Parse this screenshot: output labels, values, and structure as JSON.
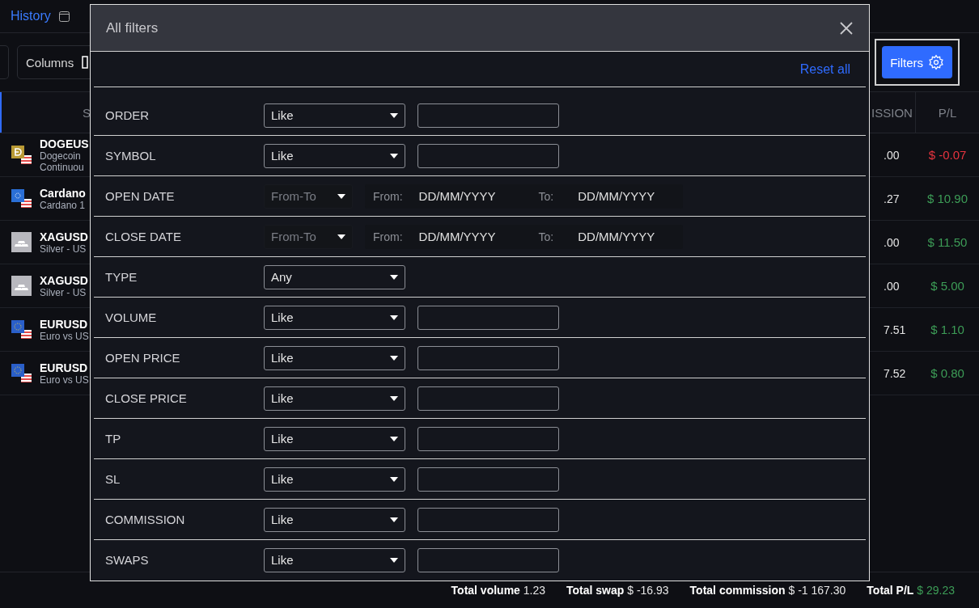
{
  "header": {
    "tab": "History"
  },
  "toolbar": {
    "columns_button": "Columns",
    "filters_button": "Filters"
  },
  "table": {
    "columns": [
      "S",
      "ISSION",
      "P/L"
    ],
    "rows": [
      {
        "kind": "doge",
        "symbol": "DOGEUS",
        "lines": [
          "Dogecoin",
          "Continuou"
        ],
        "commission": ".00",
        "pl": "$ -0.07",
        "color": "#e8343f"
      },
      {
        "kind": "cardano",
        "symbol": "Cardano",
        "lines": [
          "Cardano 1"
        ],
        "commission": ".27",
        "pl": "$ 10.90",
        "color": "#3d9d57"
      },
      {
        "kind": "metal",
        "symbol": "XAGUSD",
        "lines": [
          "Silver - US"
        ],
        "commission": ".00",
        "pl": "$ 11.50",
        "color": "#3d9d57"
      },
      {
        "kind": "metal",
        "symbol": "XAGUSD",
        "lines": [
          "Silver - US"
        ],
        "commission": ".00",
        "pl": "$ 5.00",
        "color": "#3d9d57"
      },
      {
        "kind": "euro",
        "symbol": "EURUSD",
        "lines": [
          "Euro vs US"
        ],
        "commission": "7.51",
        "pl": "$ 1.10",
        "color": "#3d9d57"
      },
      {
        "kind": "euro",
        "symbol": "EURUSD",
        "lines": [
          "Euro vs US"
        ],
        "commission": "7.52",
        "pl": "$ 0.80",
        "color": "#3d9d57"
      }
    ]
  },
  "totals": [
    {
      "label": "Total volume",
      "value": "1.23",
      "color": "#e6e6e6"
    },
    {
      "label": "Total swap",
      "value": "$ -16.93",
      "color": "#e6e6e6"
    },
    {
      "label": "Total commission",
      "value": "$ -1 167.30",
      "color": "#e6e6e6"
    },
    {
      "label": "Total P/L",
      "value": "$ 29.23",
      "color": "#3d9d57"
    }
  ],
  "dialog": {
    "title": "All filters",
    "reset": "Reset all",
    "filters": [
      {
        "kind": "text",
        "label": "ORDER",
        "operator": "Like"
      },
      {
        "kind": "text",
        "label": "SYMBOL",
        "operator": "Like"
      },
      {
        "kind": "date",
        "label": "OPEN DATE",
        "operator": "From-To",
        "from_label": "From:",
        "from_placeholder": "DD/MM/YYYY",
        "to_label": "To:",
        "to_placeholder": "DD/MM/YYYY"
      },
      {
        "kind": "date",
        "label": "CLOSE DATE",
        "operator": "From-To",
        "from_label": "From:",
        "from_placeholder": "DD/MM/YYYY",
        "to_label": "To:",
        "to_placeholder": "DD/MM/YYYY"
      },
      {
        "kind": "select",
        "label": "TYPE",
        "operator": "Any"
      },
      {
        "kind": "text",
        "label": "VOLUME",
        "operator": "Like"
      },
      {
        "kind": "text",
        "label": "OPEN PRICE",
        "operator": "Like"
      },
      {
        "kind": "text",
        "label": "CLOSE PRICE",
        "operator": "Like"
      },
      {
        "kind": "text",
        "label": "TP",
        "operator": "Like"
      },
      {
        "kind": "text",
        "label": "SL",
        "operator": "Like"
      },
      {
        "kind": "text",
        "label": "COMMISSION",
        "operator": "Like"
      },
      {
        "kind": "text",
        "label": "SWAPS",
        "operator": "Like"
      }
    ]
  }
}
